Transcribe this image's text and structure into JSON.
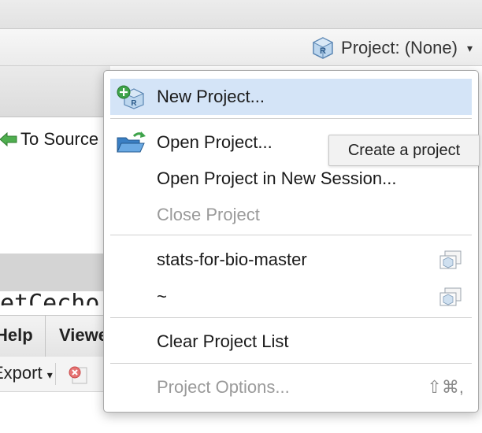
{
  "project_bar": {
    "label": "Project: (None)",
    "icon": "r-project-cube-icon",
    "caret": "▾"
  },
  "left_pane": {
    "to_source": "To Source",
    "code_fragment": "etCecho",
    "tabs": {
      "help": "Help",
      "viewer": "Viewer"
    },
    "export_label": "Export",
    "export_caret": "▾"
  },
  "menu": {
    "items": [
      {
        "label": "New Project...",
        "icon": "new-project-icon",
        "highlighted": true
      },
      {
        "label": "Open Project...",
        "icon": "open-folder-icon"
      },
      {
        "label": "Open Project in New Session..."
      },
      {
        "label": "Close Project",
        "disabled": true
      },
      {
        "label": "stats-for-bio-master",
        "icon": "open-in-new-session-icon"
      },
      {
        "label": "~",
        "icon": "open-in-new-session-icon"
      },
      {
        "label": "Clear Project List"
      },
      {
        "label": "Project Options...",
        "disabled": true,
        "shortcut": "⇧⌘,"
      }
    ]
  },
  "tooltip": "Create a project",
  "colors": {
    "highlight": "#d4e4f7",
    "disabled_text": "#9a9a9a",
    "accent_green": "#3ea34a",
    "accent_blue": "#3a7fc3"
  }
}
